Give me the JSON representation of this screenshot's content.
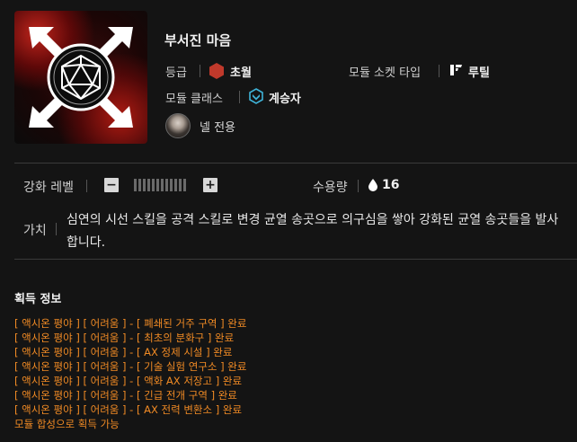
{
  "module": {
    "name": "부서진 마음",
    "grade_label": "등급",
    "grade_value": "초월",
    "socket_label": "모듈 소켓 타입",
    "socket_value": "루틸",
    "class_label": "모듈 클래스",
    "class_value": "계승자",
    "exclusive_label": "넬 전용",
    "icon": "d20-with-arrows-icon",
    "colors": {
      "grade_hex": "#c0392b",
      "class_icon": "#3fb3d8",
      "acquisition_text": "#f08a24"
    }
  },
  "stats": {
    "enhance_label": "강화 레벨",
    "enhance_level": 0,
    "enhance_max": 10,
    "capacity_label": "수용량",
    "capacity_value": "16"
  },
  "value_section": {
    "label": "가치",
    "description": "심연의 시선 스킬을 공격 스킬로 변경 균열 송곳으로 의구심을 쌓아 강화된 균열 송곳들을 발사합니다."
  },
  "acquisition": {
    "title": "획득 정보",
    "items": [
      "[ 액시온 평야 ] [ 어려움 ] - [ 폐쇄된 거주 구역 ] 완료",
      "[ 액시온 평야 ] [ 어려움 ] - [ 최초의 분화구 ] 완료",
      "[ 액시온 평야 ] [ 어려움 ] - [ AX 정제 시설 ] 완료",
      "[ 액시온 평야 ] [ 어려움 ] - [ 기술 실험 연구소 ] 완료",
      "[ 액시온 평야 ] [ 어려움 ] - [ 액화 AX 저장고 ] 완료",
      "[ 액시온 평야 ] [ 어려움 ] - [ 긴급 전개 구역 ] 완료",
      "[ 액시온 평야 ] [ 어려움 ] - [ AX 전력 변환소 ] 완료",
      "모듈 합성으로 획득 가능"
    ]
  }
}
